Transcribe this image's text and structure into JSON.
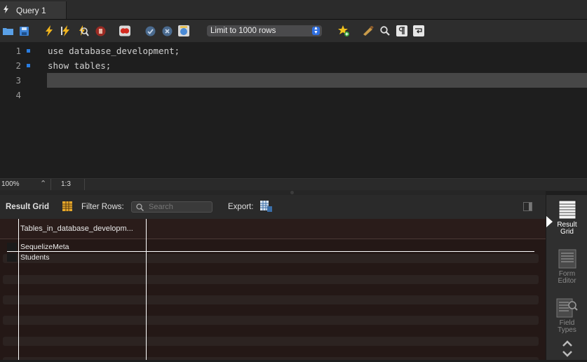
{
  "tab": {
    "label": "Query 1"
  },
  "toolbar": {
    "limit_select": "Limit to 1000 rows",
    "icons": [
      "folder-icon",
      "save-icon",
      "execute-icon",
      "execute-statement-icon",
      "explain-icon",
      "stop-icon",
      "toggle-error-icon",
      "commit-icon",
      "rollback-icon",
      "autocommit-icon",
      "bookmark-icon",
      "beautify-icon",
      "find-icon",
      "invisible-chars-icon",
      "wrap-lines-icon"
    ]
  },
  "editor": {
    "lines": [
      {
        "number": "1",
        "code": "use database_development;",
        "marked": true
      },
      {
        "number": "2",
        "code": "show tables;",
        "marked": true
      },
      {
        "number": "3",
        "code": "",
        "marked": false
      },
      {
        "number": "4",
        "code": "",
        "marked": false
      }
    ]
  },
  "status": {
    "zoom": "100%",
    "cursor": "1:3"
  },
  "results": {
    "result_grid_label": "Result Grid",
    "filter_label": "Filter Rows:",
    "search_placeholder": "Search",
    "export_label": "Export:",
    "column_header": "Tables_in_database_developm...",
    "rows": [
      "SequelizeMeta",
      "Students"
    ]
  },
  "side_panel": {
    "tabs": [
      {
        "line1": "Result",
        "line2": "Grid",
        "active": true
      },
      {
        "line1": "Form",
        "line2": "Editor",
        "active": false
      },
      {
        "line1": "Field",
        "line2": "Types",
        "active": false
      }
    ]
  }
}
